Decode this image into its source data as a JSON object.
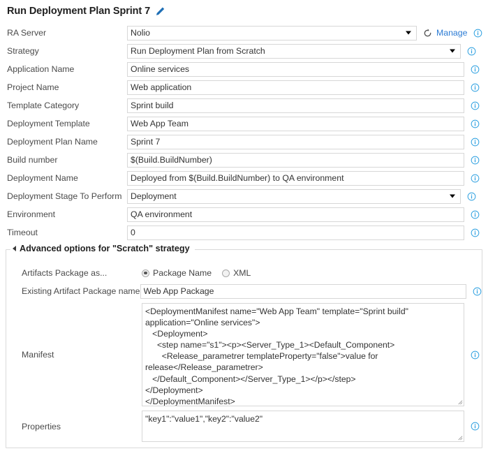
{
  "title": {
    "text": "Run Deployment Plan Sprint 7",
    "edit_icon": "pencil-icon"
  },
  "accent_color": "#2b7bd4",
  "fields": [
    {
      "label": "RA Server",
      "value": "Nolio",
      "type": "select",
      "width": "server",
      "has_refresh": true,
      "refresh_icon": "refresh-icon",
      "manage_label": "Manage",
      "info_icon": "info-icon"
    },
    {
      "label": "Strategy",
      "value": "Run Deployment Plan from Scratch",
      "type": "select",
      "width": "strategy",
      "info_icon": "info-icon"
    },
    {
      "label": "Application Name",
      "value": "Online services",
      "type": "text",
      "width": "full",
      "info_icon": "info-icon"
    },
    {
      "label": "Project Name",
      "value": "Web application",
      "type": "text",
      "width": "full",
      "info_icon": "info-icon"
    },
    {
      "label": "Template Category",
      "value": "Sprint build",
      "type": "text",
      "width": "full",
      "info_icon": "info-icon"
    },
    {
      "label": "Deployment Template",
      "value": "Web App Team",
      "type": "text",
      "width": "full",
      "info_icon": "info-icon"
    },
    {
      "label": "Deployment Plan Name",
      "value": "Sprint 7",
      "type": "text",
      "width": "full",
      "info_icon": "info-icon"
    },
    {
      "label": "Build number",
      "value": "$(Build.BuildNumber)",
      "type": "text",
      "width": "full",
      "info_icon": "info-icon"
    },
    {
      "label": "Deployment Name",
      "value": "Deployed from $(Build.BuildNumber) to QA environment",
      "type": "text",
      "width": "full",
      "info_icon": "info-icon"
    },
    {
      "label": "Deployment Stage To Perform",
      "value": "Deployment",
      "type": "select",
      "width": "strategy",
      "info_icon": "info-icon"
    },
    {
      "label": "Environment",
      "value": "QA environment",
      "type": "text",
      "width": "full",
      "info_icon": "info-icon"
    },
    {
      "label": "Timeout",
      "value": "0",
      "type": "text",
      "width": "full",
      "info_icon": "info-icon"
    }
  ],
  "advanced": {
    "legend": "Advanced options for \"Scratch\" strategy",
    "collapse_icon": "triangle-collapse-icon",
    "artifacts_label": "Artifacts Package as...",
    "radio_options": [
      {
        "label": "Package Name",
        "checked": true
      },
      {
        "label": "XML",
        "checked": false
      }
    ],
    "package_name_label": "Existing Artifact Package name",
    "package_name_value": "Web App Package",
    "manifest_label": "Manifest",
    "manifest_value": "<DeploymentManifest name=\"Web App Team\" template=\"Sprint build\" application=\"Online services\">\n   <Deployment>\n     <step name=\"s1\"><p><Server_Type_1><Default_Component>\n       <Release_parametrer templateProperty=\"false\">value for release</Release_parametrer>\n   </Default_Component></Server_Type_1></p></step>\n</Deployment>\n</DeploymentManifest>",
    "properties_label": "Properties",
    "properties_value": "\"key1\":\"value1\",\"key2\":\"value2\"",
    "info_icon": "info-icon"
  }
}
